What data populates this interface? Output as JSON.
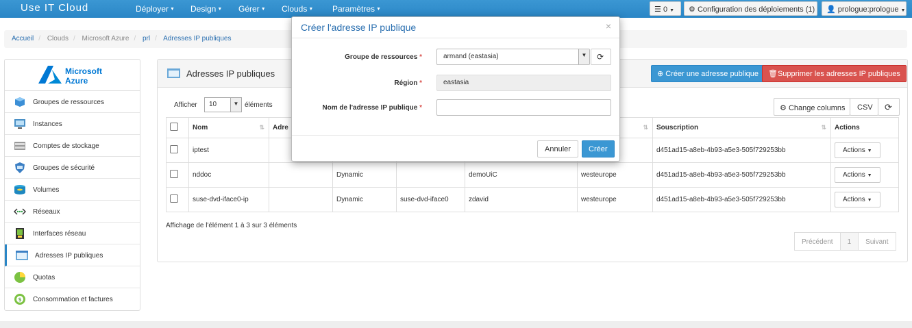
{
  "navbar": {
    "brand": "Use IT Cloud",
    "menu": [
      "Déployer",
      "Design",
      "Gérer",
      "Clouds",
      "Paramètres"
    ],
    "notif_count": "0",
    "deploy_config": "Configuration des déploiements (1)",
    "user": "prologue:prologue"
  },
  "breadcrumb": [
    "Accueil",
    "Clouds",
    "Microsoft Azure",
    "prl",
    "Adresses IP publiques"
  ],
  "sidebar": {
    "logo_line1": "Microsoft",
    "logo_line2": "Azure",
    "items": [
      {
        "label": "Groupes de ressources",
        "icon": "cube-icon"
      },
      {
        "label": "Instances",
        "icon": "monitor-icon"
      },
      {
        "label": "Comptes de stockage",
        "icon": "storage-icon"
      },
      {
        "label": "Groupes de sécurité",
        "icon": "shield-icon"
      },
      {
        "label": "Volumes",
        "icon": "disk-icon"
      },
      {
        "label": "Réseaux",
        "icon": "network-icon"
      },
      {
        "label": "Interfaces réseau",
        "icon": "nic-icon"
      },
      {
        "label": "Adresses IP publiques",
        "icon": "public-ip-icon"
      },
      {
        "label": "Quotas",
        "icon": "pie-icon"
      },
      {
        "label": "Consommation et factures",
        "icon": "billing-icon"
      }
    ]
  },
  "panel": {
    "title": "Adresses IP publiques",
    "create_button": "Créer une adresse publique",
    "delete_button": "Supprimer les adresses IP publiques",
    "show_label": "Afficher",
    "page_size": "10",
    "entries_label": "éléments",
    "change_columns": "Change columns",
    "csv": "CSV"
  },
  "table": {
    "columns": [
      "Nom",
      "Adre",
      "",
      "",
      "",
      "ent",
      "Souscription",
      "Actions"
    ],
    "rows": [
      {
        "nom": "iptest",
        "adresse": "",
        "type": "",
        "interface": "",
        "groupe": "",
        "region": "pe",
        "souscription": "d451ad15-a8eb-4b93-a5e3-505f729253bb",
        "actions": "Actions"
      },
      {
        "nom": "nddoc",
        "adresse": "",
        "type": "Dynamic",
        "interface": "",
        "groupe": "demoUiC",
        "region": "westeurope",
        "souscription": "d451ad15-a8eb-4b93-a5e3-505f729253bb",
        "actions": "Actions"
      },
      {
        "nom": "suse-dvd-iface0-ip",
        "adresse": "",
        "type": "Dynamic",
        "interface": "suse-dvd-iface0",
        "groupe": "zdavid",
        "region": "westeurope",
        "souscription": "d451ad15-a8eb-4b93-a5e3-505f729253bb",
        "actions": "Actions"
      }
    ]
  },
  "info": "Affichage de l'élément 1 à 3 sur 3 éléments",
  "pager": {
    "prev": "Précédent",
    "page": "1",
    "next": "Suivant"
  },
  "modal": {
    "title": "Créer l'adresse IP publique",
    "close": "×",
    "rg_label": "Groupe de ressources",
    "rg_value": "armand (eastasia)",
    "region_label": "Région",
    "region_value": "eastasia",
    "name_label": "Nom de l'adresse IP publique",
    "name_value": "",
    "required_mark": "*",
    "cancel": "Annuler",
    "create": "Créer"
  },
  "colors": {
    "primary": "#3b97d3",
    "danger": "#d9534f",
    "title_blue": "#2a6fb0"
  }
}
